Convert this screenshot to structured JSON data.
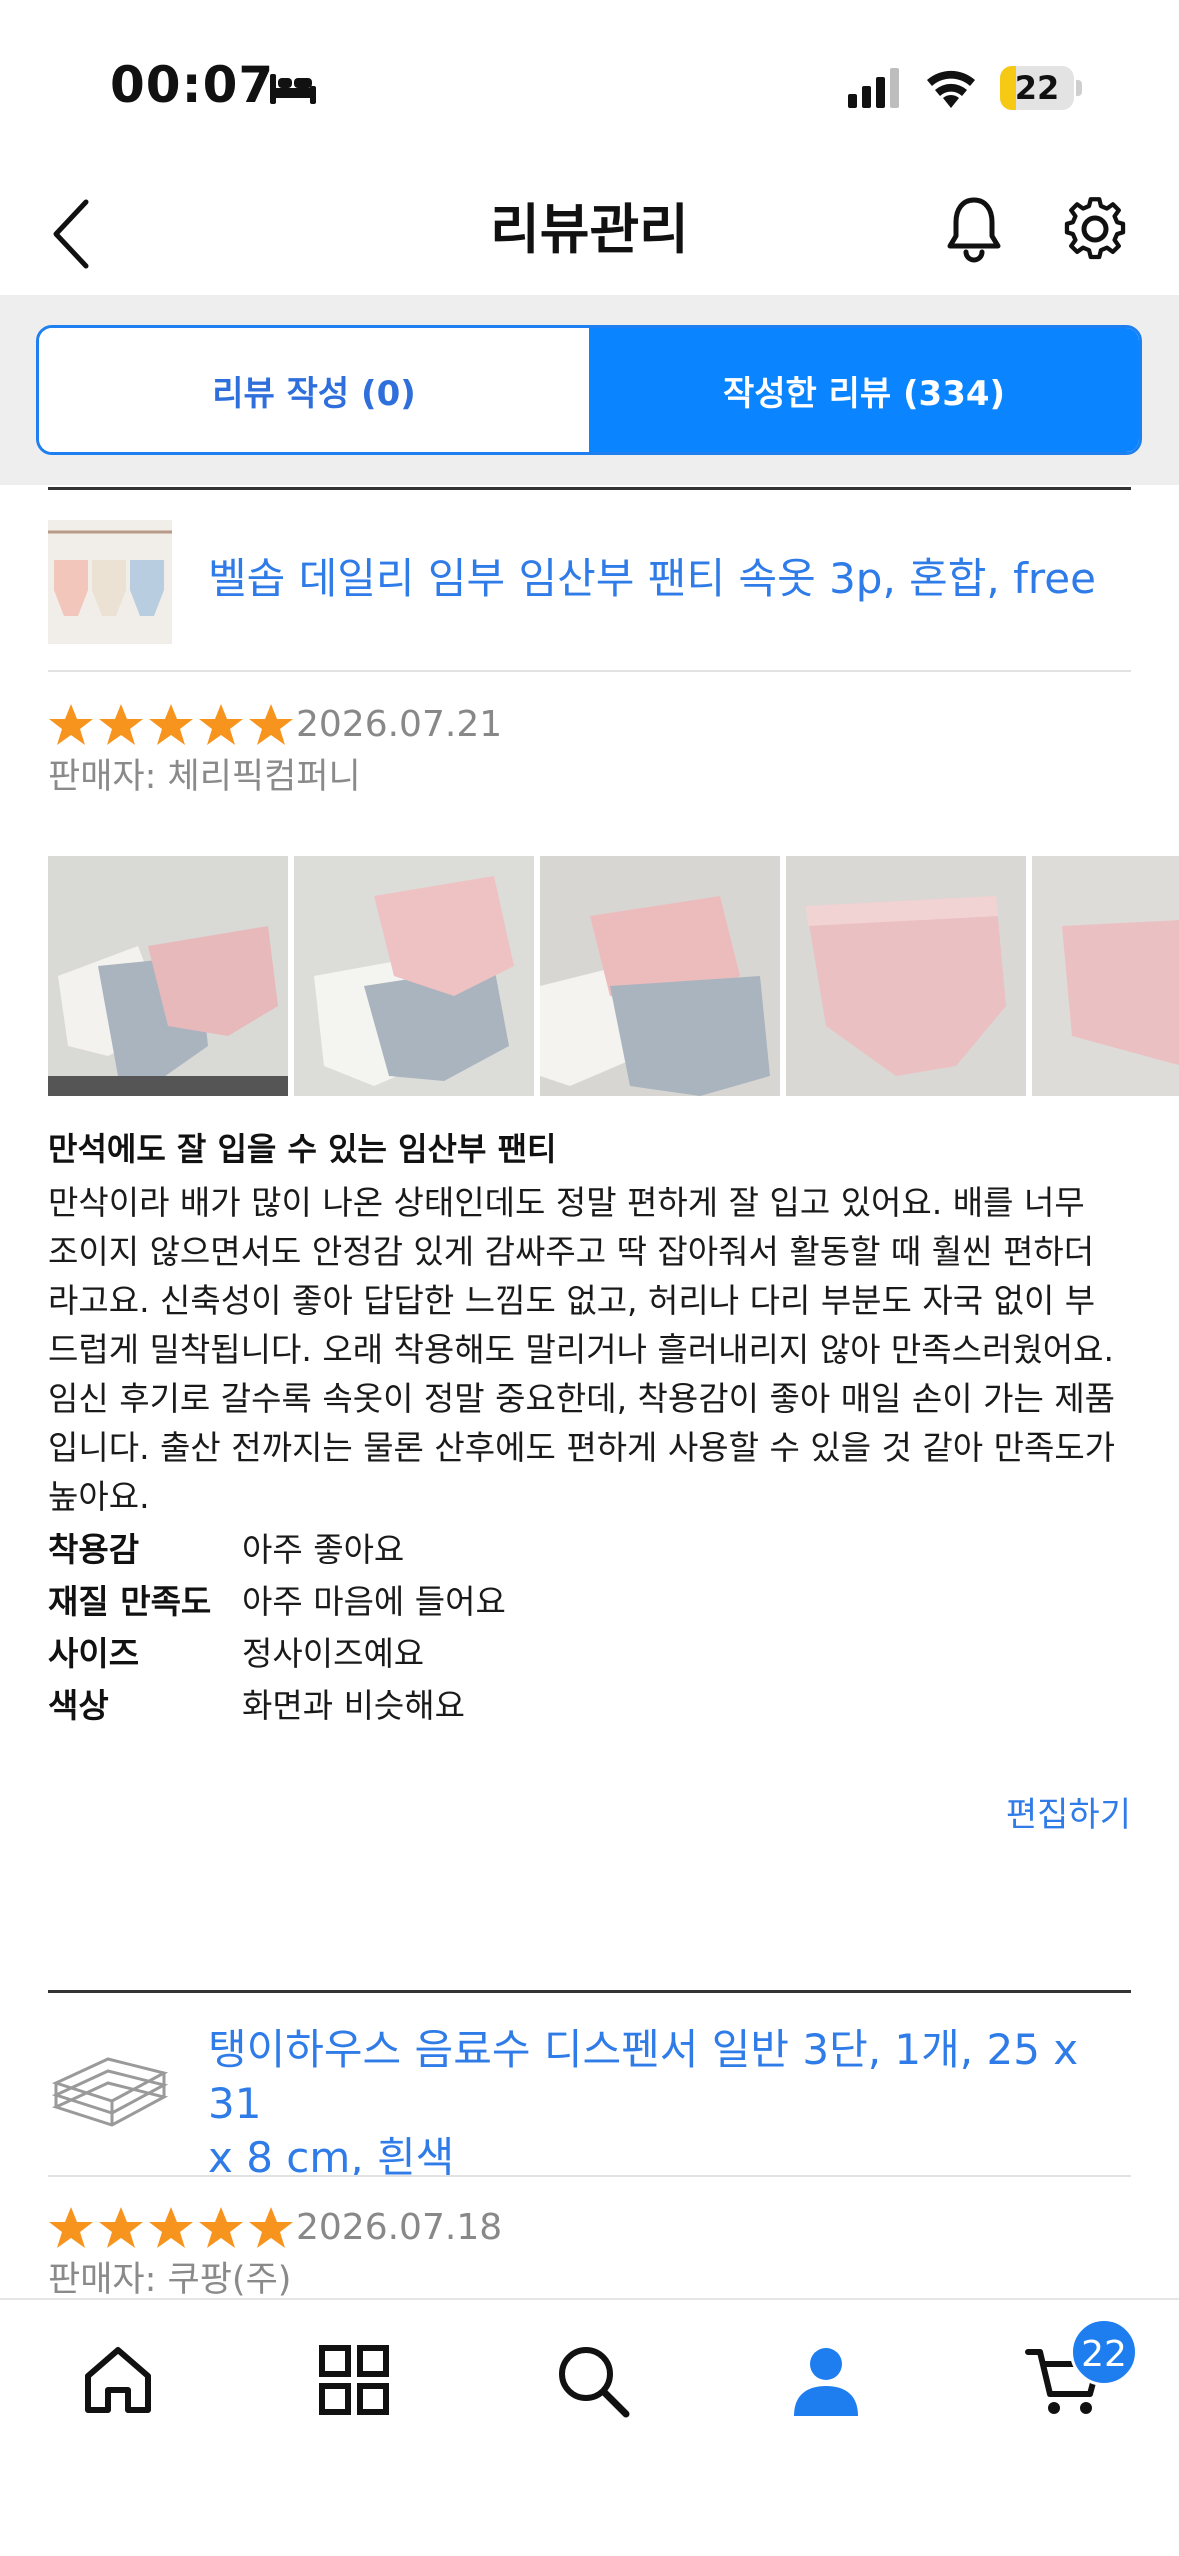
{
  "status_bar": {
    "time": "00:07",
    "battery_level": "22"
  },
  "header": {
    "title": "리뷰관리"
  },
  "tabs": [
    {
      "label": "리뷰 작성 (0)",
      "active": false
    },
    {
      "label": "작성한 리뷰 (334)",
      "active": true
    }
  ],
  "reviews": [
    {
      "product_name": "벨솝 데일리 임부 임산부 팬티 속옷 3p, 혼합, free",
      "rating": 5,
      "date": "2026.07.21",
      "seller": "판매자: 체리픽컴퍼니",
      "title": "만석에도 잘 입을 수 있는 임산부 팬티",
      "body_lines": [
        "만삭이라 배가 많이 나온 상태인데도 정말 편하게 잘 입고 있어요. 배를 너무",
        "조이지 않으면서도 안정감 있게 감싸주고 딱 잡아줘서 활동할 때 훨씬 편하더",
        "라고요. 신축성이 좋아 답답한 느낌도 없고, 허리나 다리 부분도 자국 없이 부",
        "드럽게 밀착됩니다. 오래 착용해도 말리거나 흘러내리지 않아 만족스러웠어요.",
        "임신 후기로 갈수록 속옷이 정말 중요한데, 착용감이 좋아 매일 손이 가는 제품",
        "입니다. 출산 전까지는 물론 산후에도 편하게 사용할 수 있을 것 같아 만족도가",
        "높아요."
      ],
      "attributes": [
        {
          "label": "착용감",
          "value": "아주 좋아요"
        },
        {
          "label": "재질 만족도",
          "value": "아주 마음에 들어요"
        },
        {
          "label": "사이즈",
          "value": "정사이즈예요"
        },
        {
          "label": "색상",
          "value": "화면과 비슷해요"
        }
      ],
      "edit_label": "편집하기"
    },
    {
      "product_name_lines": [
        "탱이하우스 음료수 디스펜서 일반 3단, 1개, 25 x 31",
        "x 8 cm, 흰색"
      ],
      "rating": 5,
      "date": "2026.07.18",
      "seller": "판매자: 쿠팡(주)"
    }
  ],
  "bottom_nav": {
    "items": [
      "home-icon",
      "category-icon",
      "search-icon",
      "my-page-icon",
      "cart-icon"
    ],
    "cart_count": "22",
    "active": "my-page-icon"
  },
  "colors": {
    "accent": "#0a84ff",
    "link": "#2f7ce8",
    "star": "#f7941d"
  }
}
